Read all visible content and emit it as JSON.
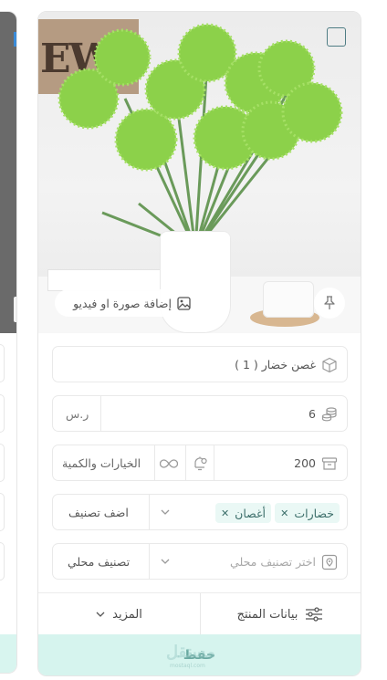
{
  "card": {
    "add_media_label": "إضافة صورة او فيديو",
    "product_name": "غصن خضار ( 1 )",
    "price": "6",
    "currency": "ر.س",
    "quantity": "200",
    "options_label": "الخيارات والكمية",
    "categories": [
      "خضارات",
      "أغصان"
    ],
    "add_category_label": "اضف تصنيف",
    "local_category_placeholder": "اختر تصنيف محلي",
    "local_category_label": "تصنيف محلي",
    "product_data_label": "بيانات المنتج",
    "more_label": "المزيد",
    "save_label": "حفظ"
  },
  "image": {
    "sign_text": "EWS"
  },
  "watermark": {
    "text": "مستقل",
    "sub": "mostaql.com"
  },
  "colors": {
    "accent": "#d6f4ee",
    "accent_text": "#6aa9a1",
    "checkbox": "#4f7d84",
    "chip_bg": "#eaf8f5"
  }
}
